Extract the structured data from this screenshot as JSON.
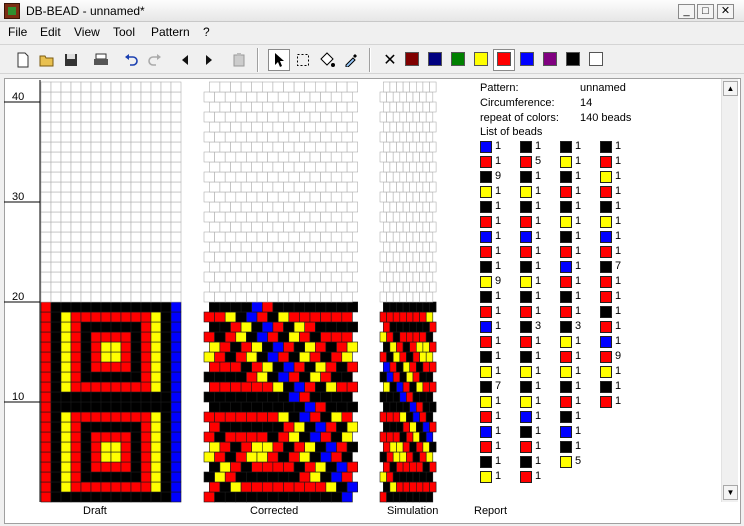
{
  "window": {
    "title": "DB-BEAD - unnamed*",
    "min": "_",
    "max": "□",
    "close": "✕"
  },
  "menu": [
    "File",
    "Edit",
    "View",
    "Tool",
    "Pattern",
    "?"
  ],
  "palette": [
    "#800000",
    "#000080",
    "#008000",
    "#ffff00",
    "#ff0000",
    "#0000ff",
    "#800080",
    "#000000",
    "#ffffff"
  ],
  "ruler": [
    "40",
    "30",
    "20",
    "10"
  ],
  "captions": {
    "draft": "Draft",
    "corrected": "Corrected",
    "simulation": "Simulation",
    "report": "Report"
  },
  "report": {
    "pattern_label": "Pattern:",
    "pattern": "unnamed",
    "circ_label": "Circumference:",
    "circ": "14",
    "repeat_label": "repeat of colors:",
    "repeat": "140 beads",
    "list_label": "List of beads"
  },
  "beads": [
    [
      [
        "b",
        "1"
      ],
      [
        "r",
        "1"
      ],
      [
        "k",
        "9"
      ],
      [
        "y",
        "1"
      ],
      [
        "k",
        "1"
      ],
      [
        "r",
        "1"
      ],
      [
        "b",
        "1"
      ],
      [
        "r",
        "1"
      ],
      [
        "k",
        "1"
      ],
      [
        "y",
        "9"
      ],
      [
        "k",
        "1"
      ],
      [
        "r",
        "1"
      ],
      [
        "b",
        "1"
      ],
      [
        "r",
        "1"
      ],
      [
        "k",
        "1"
      ],
      [
        "y",
        "1"
      ],
      [
        "k",
        "7"
      ],
      [
        "y",
        "1"
      ],
      [
        "r",
        "1"
      ],
      [
        "b",
        "1"
      ],
      [
        "r",
        "1"
      ],
      [
        "k",
        "1"
      ],
      [
        "y",
        "1"
      ]
    ],
    [
      [
        "k",
        "1"
      ],
      [
        "r",
        "5"
      ],
      [
        "k",
        "1"
      ],
      [
        "y",
        "1"
      ],
      [
        "k",
        "1"
      ],
      [
        "r",
        "1"
      ],
      [
        "b",
        "1"
      ],
      [
        "r",
        "1"
      ],
      [
        "k",
        "1"
      ],
      [
        "y",
        "1"
      ],
      [
        "k",
        "1"
      ],
      [
        "r",
        "1"
      ],
      [
        "k",
        "3"
      ],
      [
        "r",
        "1"
      ],
      [
        "k",
        "1"
      ],
      [
        "y",
        "1"
      ],
      [
        "k",
        "1"
      ],
      [
        "y",
        "1"
      ],
      [
        "b",
        "1"
      ],
      [
        "k",
        "1"
      ],
      [
        "r",
        "1"
      ],
      [
        "k",
        "1"
      ],
      [
        "r",
        "1"
      ]
    ],
    [
      [
        "k",
        "1"
      ],
      [
        "y",
        "1"
      ],
      [
        "k",
        "1"
      ],
      [
        "r",
        "1"
      ],
      [
        "k",
        "1"
      ],
      [
        "y",
        "1"
      ],
      [
        "k",
        "1"
      ],
      [
        "r",
        "1"
      ],
      [
        "b",
        "1"
      ],
      [
        "r",
        "1"
      ],
      [
        "k",
        "1"
      ],
      [
        "r",
        "1"
      ],
      [
        "k",
        "3"
      ],
      [
        "y",
        "1"
      ],
      [
        "r",
        "1"
      ],
      [
        "y",
        "1"
      ],
      [
        "k",
        "1"
      ],
      [
        "r",
        "1"
      ],
      [
        "k",
        "1"
      ],
      [
        "b",
        "1"
      ],
      [
        "k",
        "1"
      ],
      [
        "y",
        "5"
      ]
    ],
    [
      [
        "k",
        "1"
      ],
      [
        "r",
        "1"
      ],
      [
        "y",
        "1"
      ],
      [
        "r",
        "1"
      ],
      [
        "k",
        "1"
      ],
      [
        "y",
        "1"
      ],
      [
        "b",
        "1"
      ],
      [
        "r",
        "1"
      ],
      [
        "k",
        "7"
      ],
      [
        "r",
        "1"
      ],
      [
        "r",
        "1"
      ],
      [
        "k",
        "1"
      ],
      [
        "r",
        "1"
      ],
      [
        "b",
        "1"
      ],
      [
        "r",
        "9"
      ],
      [
        "y",
        "1"
      ],
      [
        "k",
        "1"
      ],
      [
        "r",
        "1"
      ]
    ]
  ],
  "bead_colors": {
    "b": "#0000ff",
    "r": "#ff0000",
    "k": "#000000",
    "y": "#ffff00"
  }
}
